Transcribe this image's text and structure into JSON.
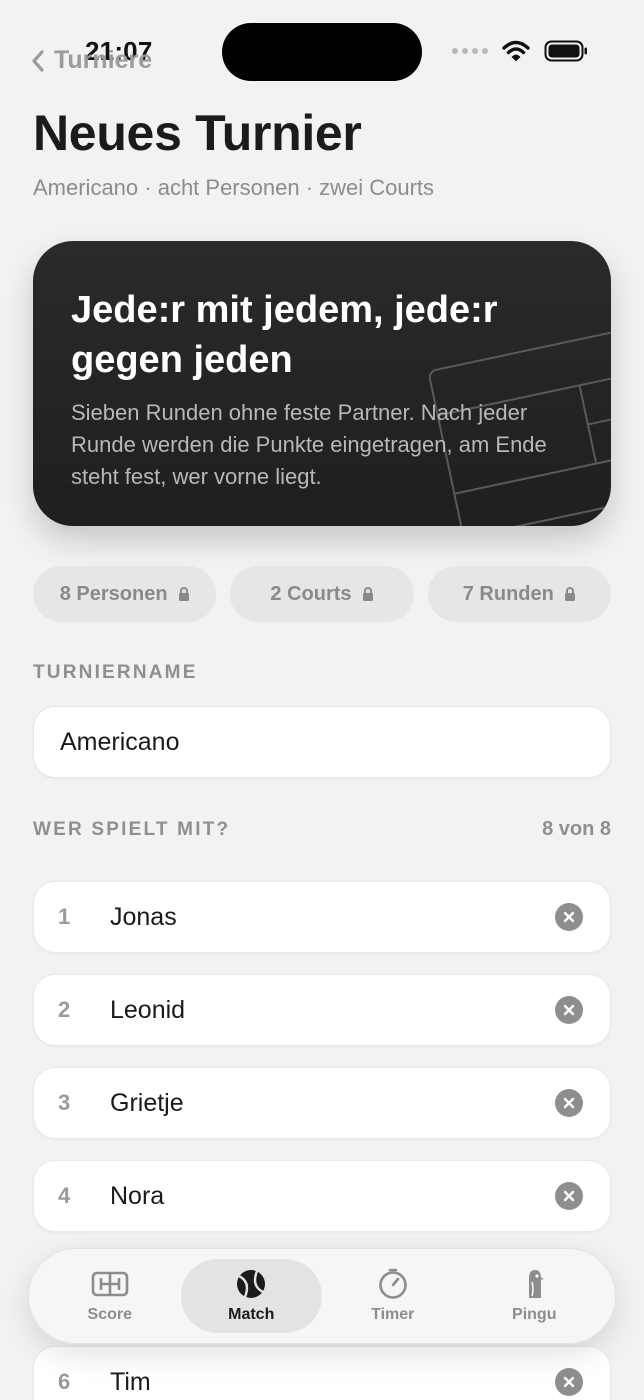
{
  "status": {
    "time": "21:07"
  },
  "nav": {
    "back_label": "Turniere"
  },
  "header": {
    "title": "Neues Turnier",
    "subtitle": "Americano · acht Personen · zwei Courts"
  },
  "hero": {
    "title": "Jede:r mit jedem, jede:r gegen jeden",
    "text": "Sieben Runden ohne feste Partner. Nach jeder Runde werden die Punkte eingetragen, am Ende steht fest, wer vorne liegt."
  },
  "pills": [
    {
      "label": "8 Personen"
    },
    {
      "label": "2 Courts"
    },
    {
      "label": "7 Runden"
    }
  ],
  "tournament_name": {
    "label": "TURNIERNAME",
    "value": "Americano"
  },
  "players": {
    "label": "WER SPIELT MIT?",
    "count": "8 von 8",
    "items": [
      {
        "number": "1",
        "name": "Jonas"
      },
      {
        "number": "2",
        "name": "Leonid"
      },
      {
        "number": "3",
        "name": "Grietje"
      },
      {
        "number": "4",
        "name": "Nora"
      },
      {
        "number": "6",
        "name": "Tim"
      }
    ]
  },
  "tabbar": {
    "items": [
      {
        "label": "Score",
        "icon": "court-icon",
        "active": false
      },
      {
        "label": "Match",
        "icon": "ball-icon",
        "active": true
      },
      {
        "label": "Timer",
        "icon": "stopwatch-icon",
        "active": false
      },
      {
        "label": "Pingu",
        "icon": "penguin-icon",
        "active": false
      }
    ]
  },
  "colors": {
    "background": "#f2f2f1",
    "hero_background": "#222222",
    "muted_text": "#8c8c8c",
    "remove_button": "#8e8e8e"
  }
}
